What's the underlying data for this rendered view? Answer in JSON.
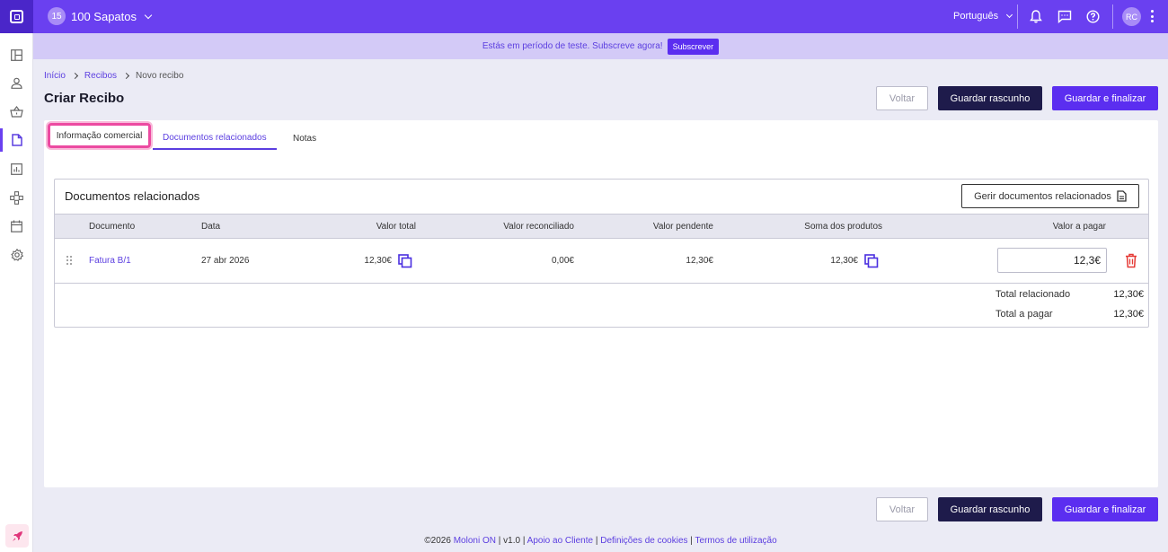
{
  "topbar": {
    "company_initials": "15",
    "company_name": "100 Sapatos",
    "language": "Português",
    "user_initials": "RC"
  },
  "banner": {
    "text": "Estás em período de teste. Subscreve agora!",
    "button": "Subscrever"
  },
  "breadcrumb": [
    "Início",
    "Recibos",
    "Novo recibo"
  ],
  "page_title": "Criar Recibo",
  "actions": {
    "back": "Voltar",
    "save_draft": "Guardar rascunho",
    "save_finalize": "Guardar e finalizar"
  },
  "tabs": [
    "Informação comercial",
    "Documentos relacionados",
    "Notas"
  ],
  "related": {
    "title": "Documentos relacionados",
    "manage_button": "Gerir documentos relacionados",
    "columns": [
      "Documento",
      "Data",
      "Valor total",
      "Valor reconciliado",
      "Valor pendente",
      "Soma dos produtos",
      "Valor a pagar"
    ],
    "rows": [
      {
        "document": "Fatura B/1",
        "date": "27 abr 2026",
        "total": "12,30€",
        "reconciled": "0,00€",
        "pending": "12,30€",
        "products_sum": "12,30€",
        "to_pay": "12,3€"
      }
    ],
    "totals": {
      "related_label": "Total relacionado",
      "related_value": "12,30€",
      "to_pay_label": "Total a pagar",
      "to_pay_value": "12,30€"
    }
  },
  "footer": {
    "copyright": "©2026",
    "brand": "Moloni ON",
    "version": "v1.0",
    "support": "Apoio ao Cliente",
    "cookies": "Definições de cookies",
    "terms": "Termos de utilização"
  },
  "colors": {
    "brand": "#6a40f0",
    "primary_button": "#5b2ef0",
    "dark_button": "#1e1b4b",
    "highlight": "#ec4aa1",
    "danger": "#e53935"
  }
}
